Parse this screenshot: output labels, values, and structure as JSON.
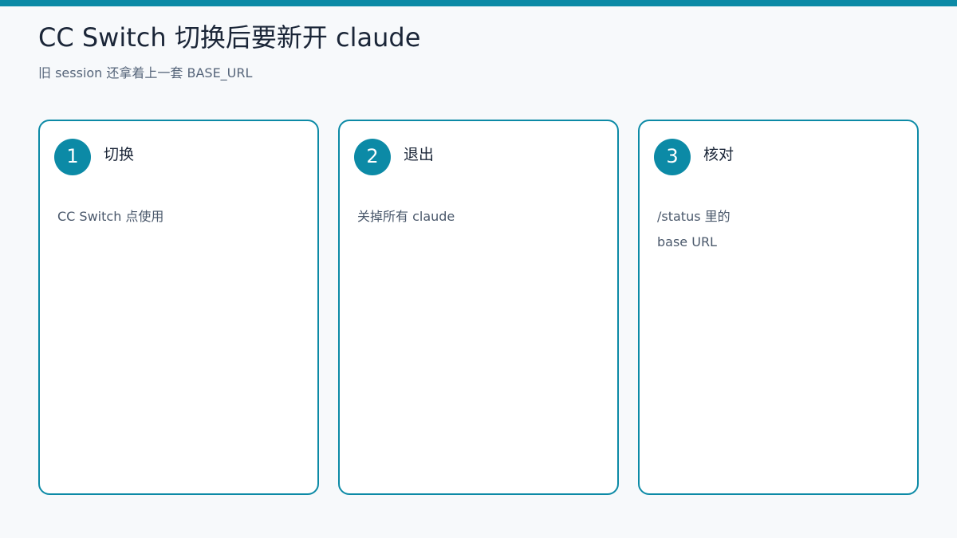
{
  "slide": {
    "title": "CC Switch 切换后要新开 claude",
    "subtitle": "旧 session 还拿着上一套 BASE_URL",
    "accent_color": "#0c8aa6"
  },
  "steps": [
    {
      "number": "1",
      "title": "切换",
      "lines": [
        "CC Switch 点使用"
      ]
    },
    {
      "number": "2",
      "title": "退出",
      "lines": [
        "关掉所有 claude"
      ]
    },
    {
      "number": "3",
      "title": "核对",
      "lines": [
        "/status 里的",
        "base URL"
      ]
    }
  ]
}
